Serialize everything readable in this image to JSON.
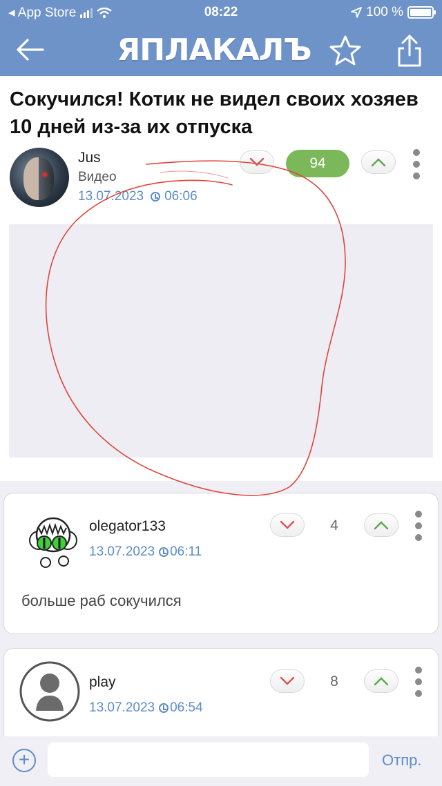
{
  "status_bar": {
    "carrier": "◂ App Store",
    "time": "08:22",
    "battery": "100 %"
  },
  "nav": {
    "logo": "ЯПЛАКАЛЪ",
    "back_icon": "arrow-left-icon",
    "bookmark_icon": "star-icon",
    "share_icon": "share-icon"
  },
  "post": {
    "title": "Сокучился! Котик не видел своих хозяев 10 дней из-за их отпуска",
    "author": "Jus",
    "category": "Видео",
    "date": "13.07.2023",
    "time": "06:06",
    "rating": "94"
  },
  "comments": [
    {
      "author": "olegator133",
      "date": "13.07.2023",
      "time": "06:11",
      "rating": "4",
      "text": "больше раб сокучился"
    },
    {
      "author": "play",
      "date": "13.07.2023",
      "time": "06:54",
      "rating": "8"
    }
  ],
  "composer": {
    "placeholder": "",
    "send_label": "Отпр."
  },
  "colors": {
    "header": "#6e93c9",
    "accent": "#5b8cc8",
    "rating_positive": "#7bb85a",
    "annotation": "#e0443a"
  }
}
